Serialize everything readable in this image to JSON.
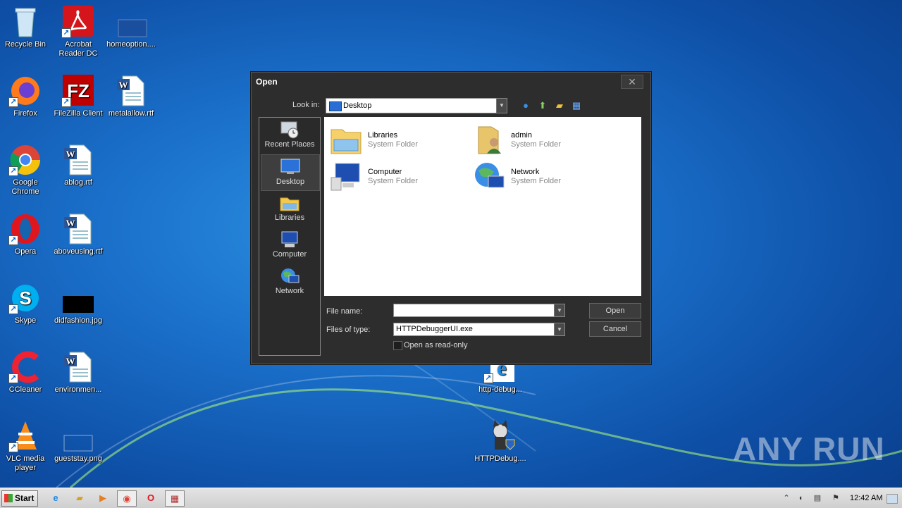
{
  "desktop": {
    "icons": [
      {
        "label": "Recycle Bin"
      },
      {
        "label": "Acrobat Reader DC"
      },
      {
        "label": "homeoption...."
      },
      {
        "label": "Firefox"
      },
      {
        "label": "FileZilla Client"
      },
      {
        "label": "metalallow.rtf"
      },
      {
        "label": "Google Chrome"
      },
      {
        "label": "ablog.rtf"
      },
      {
        "label": "Opera"
      },
      {
        "label": "aboveusing.rtf"
      },
      {
        "label": "Skype"
      },
      {
        "label": "didfashion.jpg"
      },
      {
        "label": "CCleaner"
      },
      {
        "label": "environmen..."
      },
      {
        "label": "VLC media player"
      },
      {
        "label": "gueststay.png"
      },
      {
        "label": "http-debug..."
      },
      {
        "label": "HTTPDebug...."
      }
    ],
    "watermark": "ANY RUN"
  },
  "dialog": {
    "title": "Open",
    "close_glyph": "✕",
    "look_in_label": "Look in:",
    "look_in_value": "Desktop",
    "places": [
      {
        "label": "Recent Places"
      },
      {
        "label": "Desktop"
      },
      {
        "label": "Libraries"
      },
      {
        "label": "Computer"
      },
      {
        "label": "Network"
      }
    ],
    "files": [
      {
        "name": "Libraries",
        "type": "System Folder"
      },
      {
        "name": "admin",
        "type": "System Folder"
      },
      {
        "name": "Computer",
        "type": "System Folder"
      },
      {
        "name": "Network",
        "type": "System Folder"
      }
    ],
    "file_name_label": "File name:",
    "file_name_value": "",
    "files_of_type_label": "Files of type:",
    "files_of_type_value": "HTTPDebuggerUI.exe",
    "read_only_label": "Open as read-only",
    "open_button": "Open",
    "cancel_button": "Cancel"
  },
  "taskbar": {
    "start_label": "Start",
    "clock": "12:42 AM"
  }
}
